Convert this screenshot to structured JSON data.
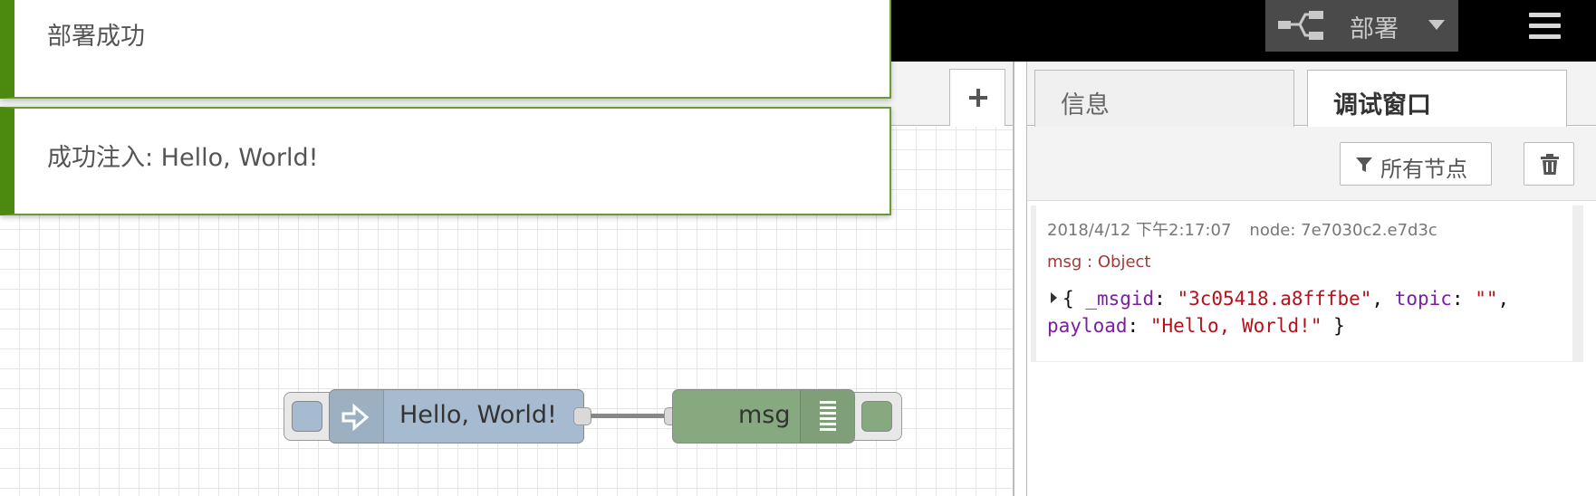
{
  "header": {
    "deploy_label": "部署",
    "deploy_icon": "deploy-icon",
    "menu_icon": "hamburger-menu-icon",
    "background": "#000000"
  },
  "workspace": {
    "add_tab_icon": "plus-icon"
  },
  "notifications": [
    {
      "text": "部署成功"
    },
    {
      "text": "成功注入: Hello, World!"
    }
  ],
  "sidebar": {
    "tabs": [
      {
        "label": "信息",
        "active": false
      },
      {
        "label": "调试窗口",
        "active": true
      }
    ],
    "filter_label": "所有节点",
    "filter_icon": "filter-icon",
    "clear_icon": "trash-icon",
    "debug_message": {
      "timestamp": "2018/4/12 下午2:17:07",
      "node": "node: 7e7030c2.e7d3c",
      "type": "msg : Object",
      "object": {
        "open": "{",
        "k1": "_msgid",
        "v1": "\"3c05418.a8fffbe\"",
        "k2": "topic",
        "v2": "\"\"",
        "k3": "payload",
        "v3": "\"Hello, World!\"",
        "close": "}"
      }
    }
  },
  "flow": {
    "inject_label": "Hello, World!",
    "inject_color": "#a6bbcf",
    "debug_label": "msg",
    "debug_color": "#87a980"
  }
}
